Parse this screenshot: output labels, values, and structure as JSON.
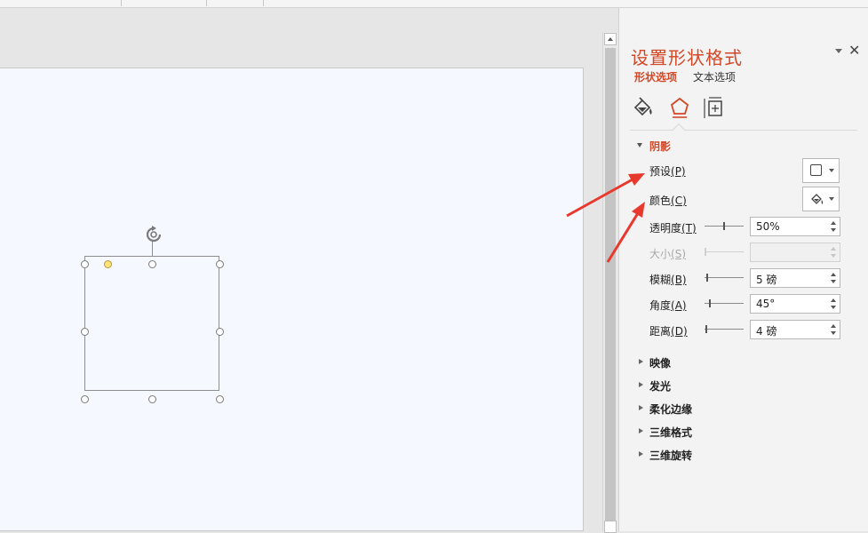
{
  "pane": {
    "title": "设置形状格式",
    "tabs": [
      {
        "label": "形状选项",
        "active": true
      },
      {
        "label": "文本选项",
        "active": false
      }
    ],
    "icons": [
      "fill-line-icon",
      "effects-icon",
      "size-properties-icon"
    ],
    "section": {
      "title": "阴影",
      "rows": [
        {
          "label_prefix": "预设",
          "label_key": "(P)",
          "control": "preset-dropdown"
        },
        {
          "label_prefix": "颜色",
          "label_key": "(C)",
          "control": "color-dropdown"
        },
        {
          "label_prefix": "透明度",
          "label_key": "(T)",
          "value": "50%",
          "slider": 0.5,
          "disabled": false
        },
        {
          "label_prefix": "大小",
          "label_key": "(S)",
          "value": "",
          "slider": 0.0,
          "disabled": true
        },
        {
          "label_prefix": "模糊",
          "label_key": "(B)",
          "value": "5 磅",
          "slider": 0.05,
          "disabled": false
        },
        {
          "label_prefix": "角度",
          "label_key": "(A)",
          "value": "45°",
          "slider": 0.125,
          "disabled": false
        },
        {
          "label_prefix": "距离",
          "label_key": "(D)",
          "value": "4 磅",
          "slider": 0.02,
          "disabled": false
        }
      ]
    },
    "collapsed_sections": [
      "映像",
      "发光",
      "柔化边缘",
      "三维格式",
      "三维旋转"
    ]
  },
  "colors": {
    "accent": "#d24726",
    "annotation_arrow": "#e8392e",
    "slide_bg": "#f5f8fe"
  }
}
